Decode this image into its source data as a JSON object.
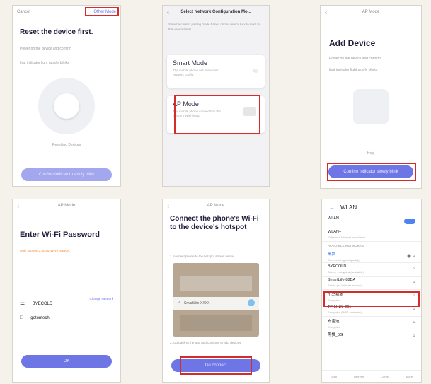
{
  "p1": {
    "cancel": "Cancel",
    "other_mode": "Other Mode",
    "title": "Reset the device first.",
    "desc1": "Power on the device and confirm",
    "desc2": "that indicator light rapidly blinks",
    "resetting": "Resetting Devices",
    "cta": "Confirm indicator rapidly blink"
  },
  "p2": {
    "title": "Select Network Configuration Mo...",
    "intro": "Select a correct pairing mode based on the device box to refer to the user manual",
    "smart_title": "Smart Mode",
    "smart_desc": "The mobile phone will broadcast network config.",
    "ap_title": "AP Mode",
    "ap_desc": "The mobile phone connects to the device's WiFi hotsp"
  },
  "p3": {
    "title": "AP Mode",
    "heading": "Add Device",
    "desc1": "Power on the device and confirm",
    "desc2": "that indicator light slowly blinks",
    "help": "Help",
    "cta": "Confirm indicator slowly blink"
  },
  "p4": {
    "title": "AP Mode",
    "heading": "Enter Wi-Fi Password",
    "note": "Only support 2.4GHz Wi-Fi network",
    "ssid": "BYECOLD",
    "change": "Change Network",
    "password": "gotontech",
    "ok": "OK"
  },
  "p5": {
    "title": "AP Mode",
    "heading": "Connect the phone's Wi-Fi to the device's hotspot",
    "step1": "1. connect phone to the hotspot shown below",
    "ssid": "SmartLife-XXXX",
    "step2": "2. Go back to the app and continue to add devices",
    "cta": "Go connect"
  },
  "p6": {
    "title": "WLAN",
    "rows_top": [
      {
        "name": "WLAN",
        "sub": ""
      },
      {
        "name": "WLAN+",
        "sub": "Enhanced Internet experience"
      }
    ],
    "section": "AVAILABLE NETWORKS",
    "rows": [
      {
        "name": "黑猫",
        "sub": "Connected (good quality)"
      },
      {
        "name": "BYECOLD",
        "sub": "Saved, encrypted (available)"
      },
      {
        "name": "SmartLife-88DA",
        "sub": "Saved (no Internet access)"
      },
      {
        "name": "小马别骑",
        "sub": "Encrypted"
      },
      {
        "name": "TP-LINK_201",
        "sub": "Encrypted (WPS available)"
      },
      {
        "name": "布雷迪",
        "sub": "Encrypted"
      },
      {
        "name": "黑猫_5G",
        "sub": ""
      }
    ],
    "bottom": [
      "Scan",
      "Refresh",
      "Config",
      "More"
    ]
  },
  "colors": {
    "accent": "#6e76e6",
    "highlight": "#d62b2b",
    "toggle": "#4f84f0"
  }
}
